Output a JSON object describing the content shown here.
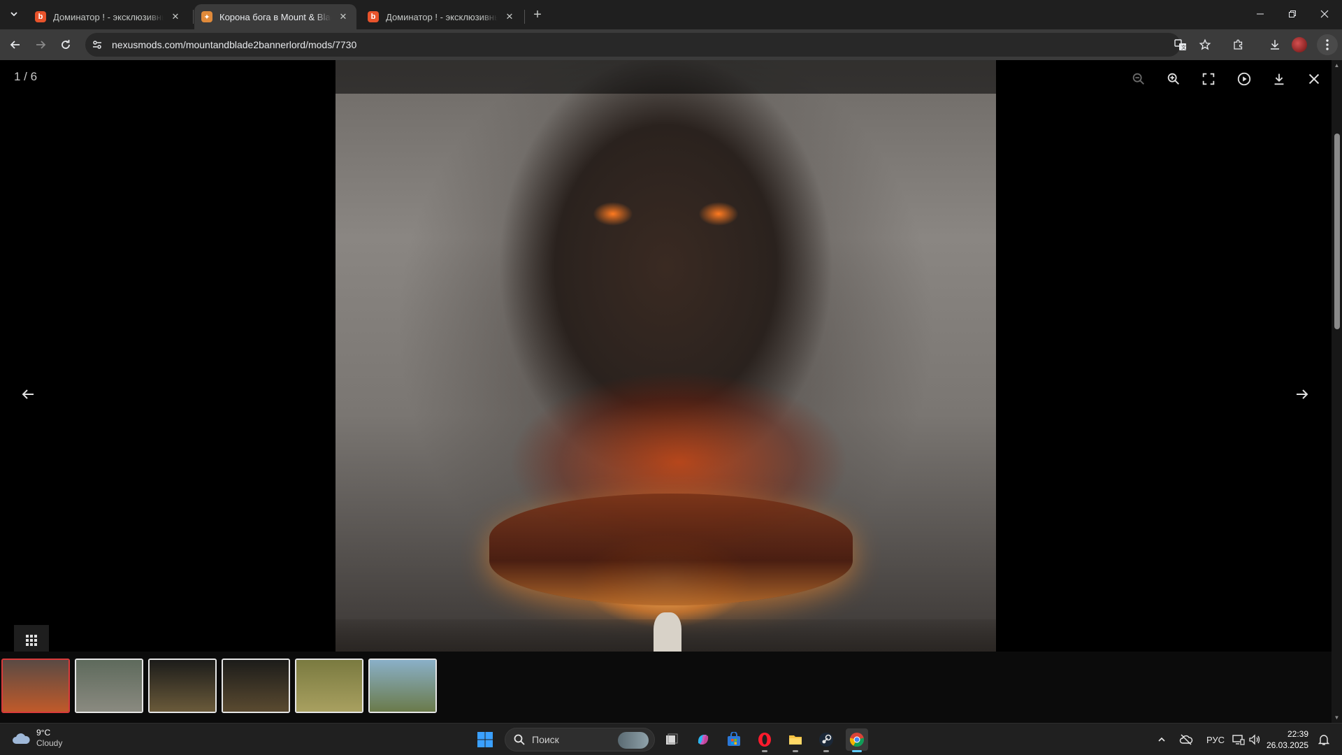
{
  "browser": {
    "tabs": [
      {
        "title": "Доминатор ! - эксклюзивный мод",
        "favicon_color": "#e8532b",
        "active": false
      },
      {
        "title": "Корона бога в Mount & Blade II",
        "favicon_color": "#e08a3a",
        "active": true
      },
      {
        "title": "Доминатор ! - эксклюзивный мод",
        "favicon_color": "#e8532b",
        "active": false
      }
    ],
    "url": "nexusmods.com/mountandblade2bannerlord/mods/7730",
    "icons": {
      "tab_search": "chevron-down-icon",
      "new_tab": "plus-icon",
      "back": "arrow-left-icon",
      "forward": "arrow-right-icon",
      "reload": "reload-icon",
      "site_info": "tune-icon",
      "translate": "translate-icon",
      "bookmark": "star-icon",
      "extensions": "puzzle-icon",
      "downloads": "download-icon",
      "menu": "kebab-icon"
    }
  },
  "viewer": {
    "counter": "1 / 6",
    "tools": [
      "zoom-out-icon",
      "zoom-in-icon",
      "fullscreen-icon",
      "slideshow-play-icon",
      "download-icon",
      "close-icon"
    ],
    "thumbnails": [
      {
        "active": true,
        "colors": [
          "#5a4a44",
          "#c05a2a"
        ]
      },
      {
        "active": false,
        "colors": [
          "#5e6a5c",
          "#8a8a80"
        ]
      },
      {
        "active": false,
        "colors": [
          "#1c1c1a",
          "#6a5a3a"
        ]
      },
      {
        "active": false,
        "colors": [
          "#1c1c1a",
          "#5a4a30"
        ]
      },
      {
        "active": false,
        "colors": [
          "#7a7a40",
          "#a8a060"
        ]
      },
      {
        "active": false,
        "colors": [
          "#8ab0c8",
          "#6a7a4a"
        ]
      }
    ],
    "accent": "#d93b3b"
  },
  "taskbar": {
    "weather": {
      "temp": "9°C",
      "condition": "Cloudy"
    },
    "search_placeholder": "Поиск",
    "language": "РУС",
    "time": "22:39",
    "date": "26.03.2025",
    "apps": [
      "windows-start-icon",
      "task-view-icon",
      "copilot-icon",
      "store-icon",
      "opera-icon",
      "file-explorer-icon",
      "steam-icon",
      "chrome-icon"
    ]
  }
}
